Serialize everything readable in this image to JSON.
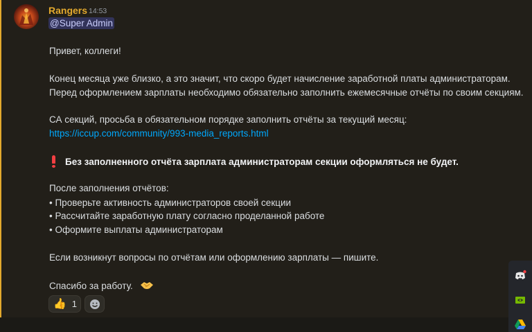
{
  "message": {
    "author": "Rangers",
    "time": "14:53",
    "mention": "@Super Admin",
    "greeting": "Привет, коллеги!",
    "p1_line1": "Конец месяца уже близко, а это значит, что скоро будет начисление заработной платы администраторам.",
    "p1_line2": "Перед оформлением зарплаты необходимо обязательно заполнить ежемесячные отчёты по своим секциям.",
    "p2_line1": "СА секций, просьба в обязательном порядке заполнить отчёты за текущий месяц:",
    "link": "https://iccup.com/community/993-media_reports.html",
    "warning": "Без заполненного отчёта зарплата администраторам секции оформляться не будет.",
    "after_title": "После заполнения отчётов:",
    "bullets": [
      "• Проверьте активность администраторов своей секции",
      "• Рассчитайте заработную плату согласно проделанной работе",
      "• Оформите выплаты администраторам"
    ],
    "questions": "Если возникнут вопросы по отчётам или оформлению зарплаты — пишите.",
    "thanks": "Спасибо за работу."
  },
  "reactions": [
    {
      "emoji": "👍",
      "count": "1"
    }
  ],
  "accent_color": "#e3a92d",
  "link_color": "#00a8fc",
  "icons": {
    "add_reaction": "smile-icon",
    "tray": [
      "discord-icon",
      "nvidia-icon",
      "google-drive-icon"
    ]
  }
}
